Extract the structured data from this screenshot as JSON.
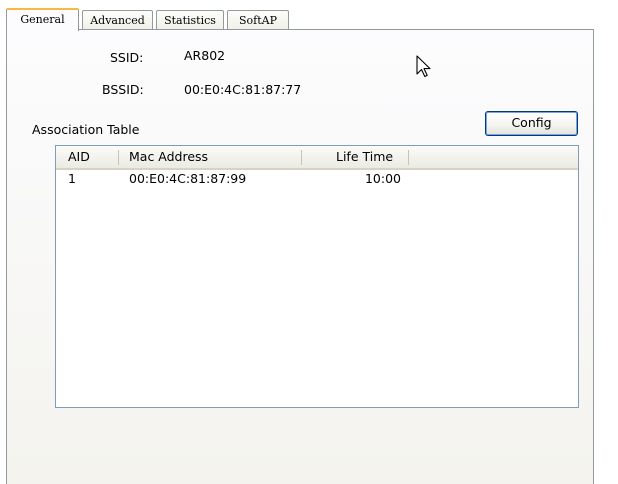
{
  "tabs": [
    {
      "label": "General",
      "active": true
    },
    {
      "label": "Advanced",
      "active": false
    },
    {
      "label": "Statistics",
      "active": false
    },
    {
      "label": "SoftAP",
      "active": false
    }
  ],
  "info": {
    "ssid_label": "SSID:",
    "ssid_value": "AR802",
    "bssid_label": "BSSID:",
    "bssid_value": "00:E0:4C:81:87:77"
  },
  "association": {
    "label": "Association Table",
    "config_label": "Config",
    "columns": [
      "AID",
      "Mac Address",
      "Life Time"
    ],
    "rows": [
      {
        "aid": "1",
        "mac": "00:E0:4C:81:87:99",
        "life": "10:00"
      }
    ]
  },
  "icons": {
    "cursor": "mouse-pointer-icon"
  },
  "colors": {
    "active_tab_highlight": "#f7b84a",
    "button_border": "#003c74",
    "list_border": "#7f9db9"
  }
}
